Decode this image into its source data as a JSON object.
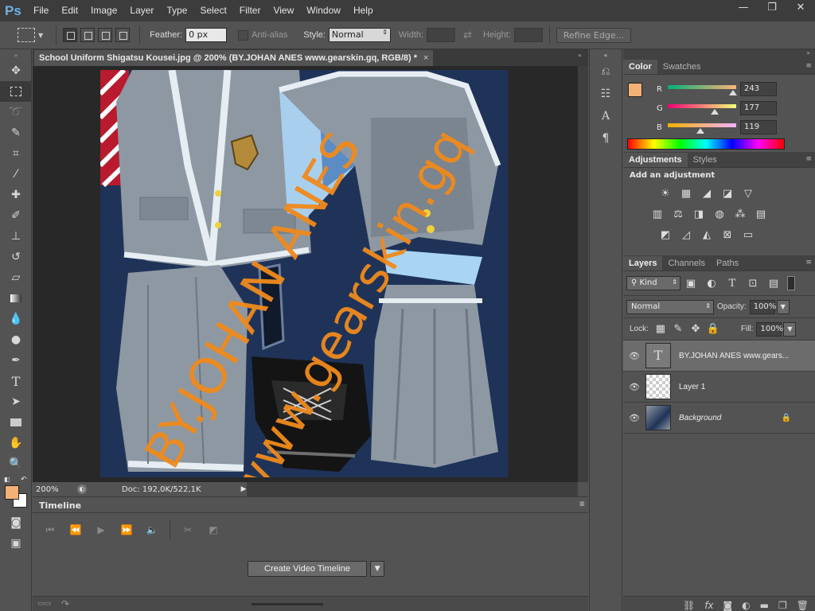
{
  "app": {
    "logo": "Ps"
  },
  "menu": [
    "File",
    "Edit",
    "Image",
    "Layer",
    "Type",
    "Select",
    "Filter",
    "View",
    "Window",
    "Help"
  ],
  "window_controls": {
    "minimize": "—",
    "restore": "❐",
    "close": "✕"
  },
  "options": {
    "feather_label": "Feather:",
    "feather_value": "0 px",
    "antialias_label": "Anti-alias",
    "style_label": "Style:",
    "style_value": "Normal",
    "width_label": "Width:",
    "height_label": "Height:",
    "refine_edge": "Refine Edge..."
  },
  "document": {
    "tab_title": "School Uniform Shigatsu Kousei.jpg @ 200% (BY.JOHAN ANES www.gearskin.gq, RGB/8) *",
    "close": "×",
    "watermark_line1": "BY.JOHAN ANES",
    "watermark_line2": "www.gearskin.gq"
  },
  "status": {
    "zoom": "200%",
    "doc_info": "Doc: 192,0K/522,1K"
  },
  "timeline": {
    "tab": "Timeline",
    "create_button": "Create Video Timeline"
  },
  "color_panel": {
    "tabs": [
      "Color",
      "Swatches"
    ],
    "r_label": "R",
    "g_label": "G",
    "b_label": "B",
    "r": 243,
    "g": 177,
    "b": 119,
    "foreground": "#f3b177"
  },
  "adjustments_panel": {
    "tabs": [
      "Adjustments",
      "Styles"
    ],
    "heading": "Add an adjustment"
  },
  "layers_panel": {
    "tabs": [
      "Layers",
      "Channels",
      "Paths"
    ],
    "kind": "Kind",
    "blend_mode": "Normal",
    "opacity_label": "Opacity:",
    "opacity": "100%",
    "lock_label": "Lock:",
    "fill_label": "Fill:",
    "fill": "100%",
    "layers": [
      {
        "name": "BY.JOHAN ANES www.gears...",
        "type": "text",
        "selected": true
      },
      {
        "name": "Layer 1",
        "type": "transparent",
        "selected": false
      },
      {
        "name": "Background",
        "type": "image",
        "selected": false
      }
    ]
  }
}
